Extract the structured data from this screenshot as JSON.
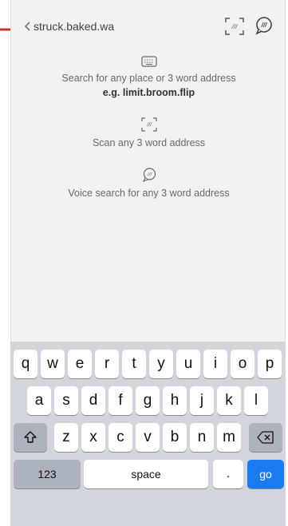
{
  "search": {
    "value": "struck.baked.wa"
  },
  "icons": {
    "back": "chevron-left-icon",
    "scan": "scan-icon",
    "voice": "voice-icon",
    "keyboard": "keyboard-icon"
  },
  "hints": {
    "search_line": "Search for any place or 3 word address",
    "search_example": "e.g. limit.broom.flip",
    "scan_line": "Scan any 3 word address",
    "voice_line": "Voice search for any 3 word address"
  },
  "keyboard": {
    "row1": [
      "q",
      "w",
      "e",
      "r",
      "t",
      "y",
      "u",
      "i",
      "o",
      "p"
    ],
    "row2": [
      "a",
      "s",
      "d",
      "f",
      "g",
      "h",
      "j",
      "k",
      "l"
    ],
    "row3": [
      "z",
      "x",
      "c",
      "v",
      "b",
      "n",
      "m"
    ],
    "numbers_label": "123",
    "space_label": "space",
    "dot_label": ".",
    "go_label": "go"
  },
  "colors": {
    "accent": "#1a7cf2",
    "annotation_arrow": "#c0392b"
  }
}
